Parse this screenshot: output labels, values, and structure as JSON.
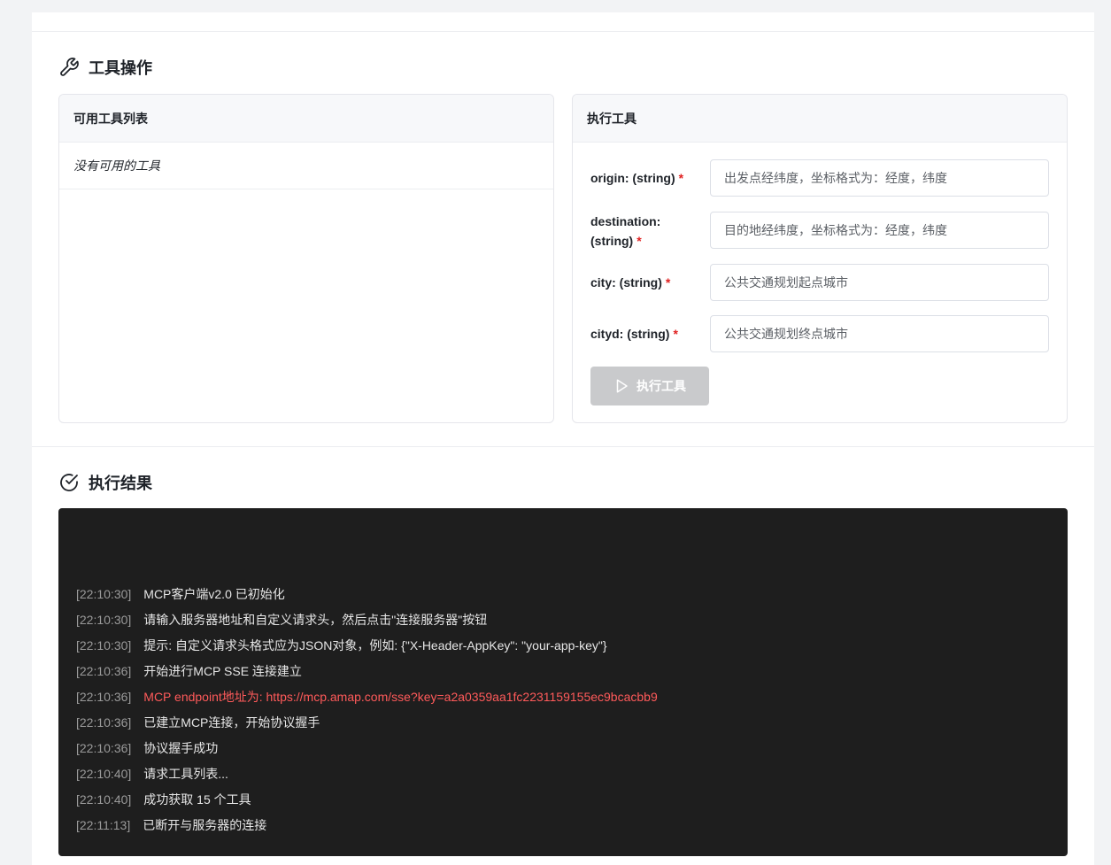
{
  "tools_section": {
    "title": "工具操作",
    "tool_list": {
      "header": "可用工具列表",
      "empty_text": "没有可用的工具"
    },
    "executor": {
      "header": "执行工具",
      "fields": [
        {
          "label": "origin: (string)",
          "required_mark": "*",
          "placeholder": "出发点经纬度，坐标格式为：经度，纬度"
        },
        {
          "label": "destination: (string)",
          "required_mark": "*",
          "placeholder": "目的地经纬度，坐标格式为：经度，纬度"
        },
        {
          "label": "city: (string)",
          "required_mark": "*",
          "placeholder": "公共交通规划起点城市"
        },
        {
          "label": "cityd: (string)",
          "required_mark": "*",
          "placeholder": "公共交通规划终点城市"
        }
      ],
      "execute_label": "执行工具"
    }
  },
  "results_section": {
    "title": "执行结果",
    "logs": [
      {
        "time": "[22:10:30]",
        "message": "MCP客户端v2.0 已初始化",
        "level": "info"
      },
      {
        "time": "[22:10:30]",
        "message": "请输入服务器地址和自定义请求头，然后点击\"连接服务器\"按钮",
        "level": "info"
      },
      {
        "time": "[22:10:30]",
        "message": "提示: 自定义请求头格式应为JSON对象，例如: {\"X-Header-AppKey\": \"your-app-key\"}",
        "level": "info"
      },
      {
        "time": "[22:10:36]",
        "message": "开始进行MCP SSE 连接建立",
        "level": "info"
      },
      {
        "time": "[22:10:36]",
        "message": "MCP endpoint地址为: https://mcp.amap.com/sse?key=a2a0359aa1fc2231159155ec9bcacbb9",
        "level": "error"
      },
      {
        "time": "[22:10:36]",
        "message": "已建立MCP连接，开始协议握手",
        "level": "info"
      },
      {
        "time": "[22:10:36]",
        "message": "协议握手成功",
        "level": "info"
      },
      {
        "time": "[22:10:40]",
        "message": "请求工具列表...",
        "level": "info"
      },
      {
        "time": "[22:10:40]",
        "message": "成功获取 15 个工具",
        "level": "info"
      },
      {
        "time": "[22:11:13]",
        "message": "已断开与服务器的连接",
        "level": "info"
      }
    ]
  },
  "colors": {
    "accent_required": "#e02020",
    "console_bg": "#1e1e1e",
    "log_error": "#ff5a5a",
    "button_disabled": "#c9cacc"
  },
  "icons": {
    "tools_title": "wrench-icon",
    "results_title": "check-circle-icon",
    "execute": "play-icon"
  }
}
